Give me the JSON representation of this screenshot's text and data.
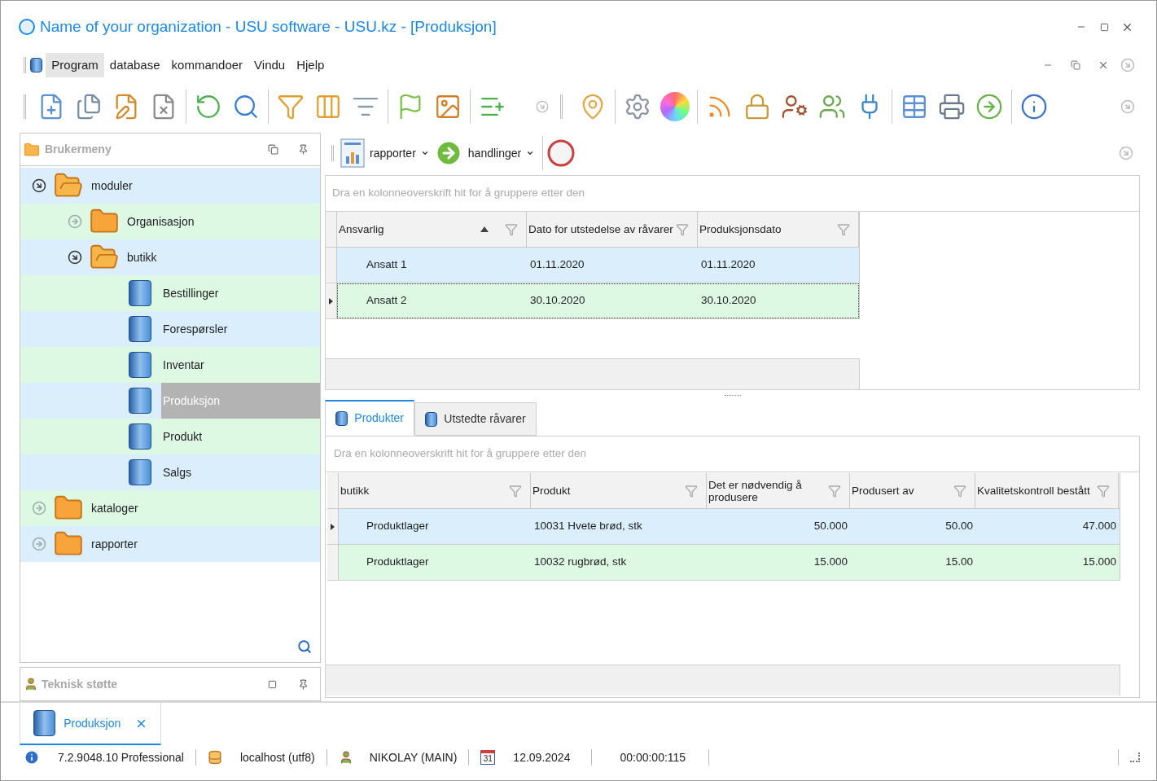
{
  "window": {
    "title": "Name of your organization - USU software - USU.kz - [Produksjon]"
  },
  "menu": [
    {
      "label": "Program",
      "selected": true
    },
    {
      "label": "database",
      "selected": false
    },
    {
      "label": "kommandoer",
      "selected": false
    },
    {
      "label": "Vindu",
      "selected": false
    },
    {
      "label": "Hjelp",
      "selected": false
    }
  ],
  "sidebar": {
    "title": "Brukermeny",
    "tree": [
      {
        "label": "moduler",
        "kind": "folder",
        "expanded": true,
        "selected": false,
        "children": [
          {
            "label": "Organisasjon",
            "kind": "folder",
            "expanded": false,
            "selected": false
          },
          {
            "label": "butikk",
            "kind": "folder",
            "expanded": true,
            "selected": false,
            "children": [
              {
                "label": "Bestillinger",
                "kind": "document",
                "selected": false
              },
              {
                "label": "Forespørsler",
                "kind": "document",
                "selected": false
              },
              {
                "label": "Inventar",
                "kind": "document",
                "selected": false
              },
              {
                "label": "Produksjon",
                "kind": "document",
                "selected": true
              },
              {
                "label": "Produkt",
                "kind": "document",
                "selected": false
              },
              {
                "label": "Salgs",
                "kind": "document",
                "selected": false
              }
            ]
          }
        ]
      },
      {
        "label": "kataloger",
        "kind": "folder",
        "expanded": false,
        "selected": false
      },
      {
        "label": "rapporter",
        "kind": "folder",
        "expanded": false,
        "selected": false
      }
    ]
  },
  "support_panel": {
    "title": "Teknisk støtte"
  },
  "content_toolbar": [
    {
      "label": "rapporter",
      "kind": "reports"
    },
    {
      "label": "handlinger",
      "kind": "actions"
    }
  ],
  "main_grid": {
    "group_hint": "Dra en kolonneoverskrift hit for å gruppere etter den",
    "columns": [
      {
        "label": "Ansvarlig",
        "sorted": true
      },
      {
        "label": "Dato for utstedelse av råvarer",
        "sorted": false
      },
      {
        "label": "Produksjonsdato",
        "sorted": false
      }
    ],
    "rows": [
      {
        "selected": false,
        "cells": [
          "Ansatt 1",
          "01.11.2020",
          "01.11.2020"
        ]
      },
      {
        "selected": true,
        "cells": [
          "Ansatt 2",
          "30.10.2020",
          "30.10.2020"
        ]
      }
    ]
  },
  "detail_tabs": [
    {
      "label": "Produkter",
      "selected": true
    },
    {
      "label": "Utstedte råvarer",
      "selected": false
    }
  ],
  "detail_grid": {
    "group_hint": "Dra en kolonneoverskrift hit for å gruppere etter den",
    "columns": [
      {
        "label": "butikk",
        "kind": "text"
      },
      {
        "label": "Produkt",
        "kind": "text"
      },
      {
        "label": "Det er nødvendig å produsere",
        "kind": "number"
      },
      {
        "label": "Produsert av",
        "kind": "number"
      },
      {
        "label": "Kvalitetskontroll bestått",
        "kind": "number"
      }
    ],
    "rows": [
      {
        "selected": true,
        "cells": [
          "Produktlager",
          "10031 Hvete brød, stk",
          "50.000",
          "50.00",
          "47.000"
        ]
      },
      {
        "selected": false,
        "cells": [
          "Produktlager",
          "10032 rugbrød, stk",
          "15.000",
          "15.00",
          "15.000"
        ]
      }
    ]
  },
  "document_tabs": [
    {
      "label": "Produksjon",
      "selected": true
    }
  ],
  "status_bar": {
    "version": "7.2.9048.10 Professional",
    "server": "localhost (utf8)",
    "user": "NIKOLAY (MAIN)",
    "calendar_day": "31",
    "date": "12.09.2024",
    "timer": "00:00:00:115"
  }
}
